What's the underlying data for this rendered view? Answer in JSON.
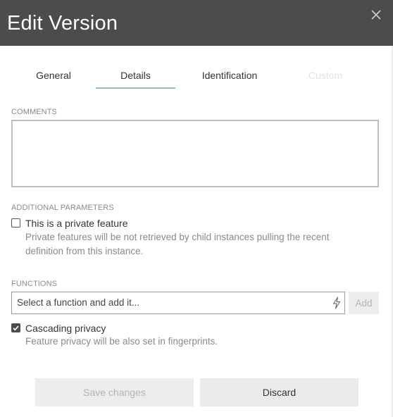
{
  "dialog": {
    "title": "Edit Version",
    "close_icon": "close-icon"
  },
  "tabs": [
    {
      "label": "General",
      "state": "normal"
    },
    {
      "label": "Details",
      "state": "active"
    },
    {
      "label": "Identification",
      "state": "normal"
    },
    {
      "label": "Custom",
      "state": "disabled"
    }
  ],
  "comments": {
    "label": "COMMENTS",
    "value": ""
  },
  "additional_parameters": {
    "label": "ADDITIONAL PARAMETERS",
    "private_feature": {
      "checked": false,
      "label": "This is a private feature",
      "help_line1": "Private features will be not retrieved by child instances pulling the recent",
      "help_line2": "definition from this instance."
    }
  },
  "functions": {
    "label": "FUNCTIONS",
    "input_placeholder": "Select a function and add it...",
    "input_icon": "lightning-bolt-icon",
    "add_label": "Add",
    "cascading_privacy": {
      "checked": true,
      "label": "Cascading privacy",
      "help": "Feature privacy will be also set in fingerprints."
    }
  },
  "footer": {
    "save_label": "Save changes",
    "discard_label": "Discard"
  },
  "colors": {
    "header_bg": "#4c4c4c",
    "tab_underline": "#8fbcb6",
    "disabled_text": "#b4b4b4"
  }
}
